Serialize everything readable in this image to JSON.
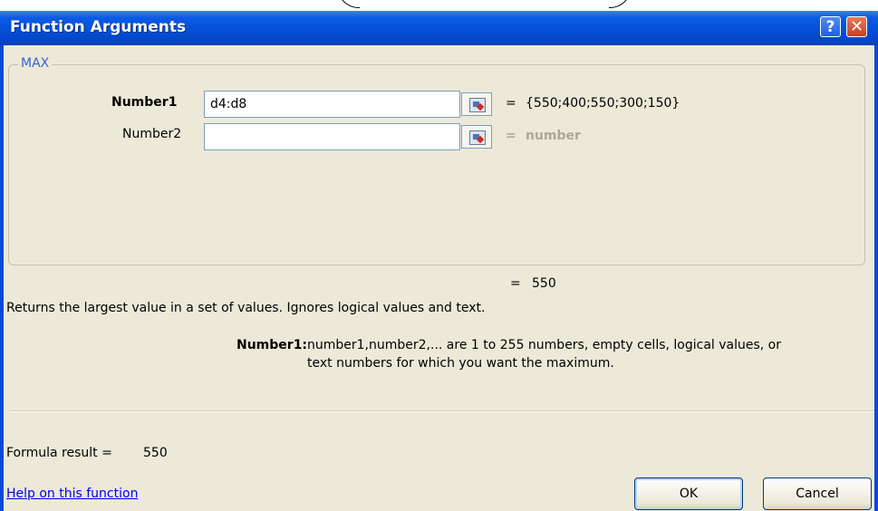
{
  "window": {
    "title": "Function Arguments",
    "help_glyph": "?",
    "close_glyph": "✕"
  },
  "function": {
    "name": "MAX",
    "args": [
      {
        "label": "Number1",
        "value": "d4:d8",
        "result": "{550;400;550;300;150}"
      },
      {
        "label": "Number2",
        "value": "",
        "result": "number"
      }
    ],
    "equals": "=",
    "result": "550"
  },
  "description": "Returns the largest value in a set of values. Ignores logical values and text.",
  "arg_help": {
    "label": "Number1:",
    "line1": "number1,number2,... are 1 to 255 numbers, empty cells, logical values, or",
    "line2": "text numbers for which you want the maximum."
  },
  "formula_result": {
    "label": "Formula result =",
    "value": "550"
  },
  "footer": {
    "help_link": "Help on this function",
    "ok": "OK",
    "cancel": "Cancel"
  },
  "icons": {
    "reference": "range-picker-icon"
  },
  "colors": {
    "title_bar": "#0450d9",
    "dialog_bg": "#ece9d8",
    "group_label": "#3a62d8",
    "link": "#0000ee"
  }
}
